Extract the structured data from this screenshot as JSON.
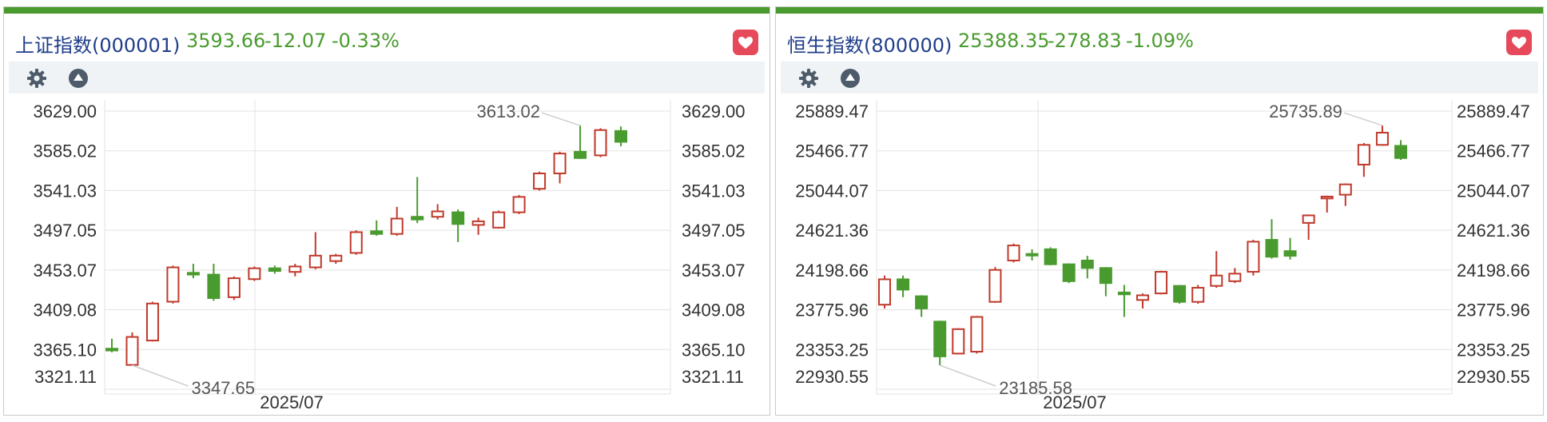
{
  "panels": [
    {
      "name": "上证指数",
      "code": "(000001)",
      "price": "3593.66",
      "change": "-12.07",
      "pct": "-0.33%",
      "chart_data": {
        "type": "candlestick",
        "x_label": "2025/07",
        "y_ticks": [
          "3629.00",
          "3585.02",
          "3541.03",
          "3497.05",
          "3453.07",
          "3409.08",
          "3365.10",
          "3321.11"
        ],
        "ylim": [
          3321.11,
          3629.0
        ],
        "annotations": {
          "high": "3613.02",
          "low": "3347.65"
        },
        "candles": [
          {
            "o": 3366.0,
            "c": 3364.0,
            "h": 3377.0,
            "l": 3362.0
          },
          {
            "o": 3348.0,
            "c": 3379.0,
            "h": 3384.0,
            "l": 3347.65
          },
          {
            "o": 3375.0,
            "c": 3416.0,
            "h": 3418.0,
            "l": 3374.0
          },
          {
            "o": 3418.0,
            "c": 3456.0,
            "h": 3458.0,
            "l": 3416.0
          },
          {
            "o": 3450.0,
            "c": 3448.0,
            "h": 3460.0,
            "l": 3444.0
          },
          {
            "o": 3448.0,
            "c": 3422.0,
            "h": 3460.0,
            "l": 3419.0
          },
          {
            "o": 3423.0,
            "c": 3444.0,
            "h": 3446.0,
            "l": 3420.0
          },
          {
            "o": 3443.0,
            "c": 3455.0,
            "h": 3457.0,
            "l": 3441.0
          },
          {
            "o": 3455.0,
            "c": 3452.0,
            "h": 3458.0,
            "l": 3449.0
          },
          {
            "o": 3451.0,
            "c": 3457.0,
            "h": 3460.0,
            "l": 3446.0
          },
          {
            "o": 3456.0,
            "c": 3469.0,
            "h": 3495.0,
            "l": 3454.0
          },
          {
            "o": 3463.0,
            "c": 3469.0,
            "h": 3471.0,
            "l": 3460.0
          },
          {
            "o": 3472.0,
            "c": 3495.0,
            "h": 3497.0,
            "l": 3470.0
          },
          {
            "o": 3496.0,
            "c": 3493.0,
            "h": 3508.0,
            "l": 3491.0
          },
          {
            "o": 3493.0,
            "c": 3510.0,
            "h": 3523.0,
            "l": 3491.0
          },
          {
            "o": 3512.0,
            "c": 3509.0,
            "h": 3556.0,
            "l": 3505.0
          },
          {
            "o": 3512.0,
            "c": 3518.0,
            "h": 3526.0,
            "l": 3509.0
          },
          {
            "o": 3517.0,
            "c": 3504.0,
            "h": 3520.0,
            "l": 3484.0
          },
          {
            "o": 3503.0,
            "c": 3507.0,
            "h": 3511.0,
            "l": 3492.0
          },
          {
            "o": 3500.0,
            "c": 3517.0,
            "h": 3519.0,
            "l": 3499.0
          },
          {
            "o": 3517.0,
            "c": 3534.0,
            "h": 3536.0,
            "l": 3515.0
          },
          {
            "o": 3543.0,
            "c": 3560.0,
            "h": 3562.0,
            "l": 3541.0
          },
          {
            "o": 3560.0,
            "c": 3582.0,
            "h": 3584.0,
            "l": 3549.0
          },
          {
            "o": 3584.0,
            "c": 3577.0,
            "h": 3613.02,
            "l": 3576.0
          },
          {
            "o": 3580.0,
            "c": 3608.0,
            "h": 3610.0,
            "l": 3578.0
          },
          {
            "o": 3607.0,
            "c": 3595.0,
            "h": 3612.0,
            "l": 3590.0
          }
        ]
      }
    },
    {
      "name": "恒生指数",
      "code": "(800000)",
      "price": "25388.35",
      "change": "-278.83",
      "pct": "-1.09%",
      "chart_data": {
        "type": "candlestick",
        "x_label": "2025/07",
        "y_ticks": [
          "25889.47",
          "25466.77",
          "25044.07",
          "24621.36",
          "24198.66",
          "23775.96",
          "23353.25",
          "22930.55"
        ],
        "ylim": [
          22930.55,
          25889.47
        ],
        "annotations": {
          "high": "25735.89",
          "low": "23185.58"
        },
        "candles": [
          {
            "o": 23830.0,
            "c": 24100.0,
            "h": 24140.0,
            "l": 23790.0
          },
          {
            "o": 24100.0,
            "c": 23990.0,
            "h": 24140.0,
            "l": 23910.0
          },
          {
            "o": 23920.0,
            "c": 23790.0,
            "h": 23930.0,
            "l": 23700.0
          },
          {
            "o": 23650.0,
            "c": 23280.0,
            "h": 23660.0,
            "l": 23185.58
          },
          {
            "o": 23310.0,
            "c": 23570.0,
            "h": 23580.0,
            "l": 23300.0
          },
          {
            "o": 23330.0,
            "c": 23700.0,
            "h": 23710.0,
            "l": 23310.0
          },
          {
            "o": 23860.0,
            "c": 24200.0,
            "h": 24230.0,
            "l": 23850.0
          },
          {
            "o": 24300.0,
            "c": 24460.0,
            "h": 24480.0,
            "l": 24280.0
          },
          {
            "o": 24370.0,
            "c": 24360.0,
            "h": 24420.0,
            "l": 24300.0
          },
          {
            "o": 24420.0,
            "c": 24260.0,
            "h": 24440.0,
            "l": 24250.0
          },
          {
            "o": 24260.0,
            "c": 24080.0,
            "h": 24270.0,
            "l": 24060.0
          },
          {
            "o": 24300.0,
            "c": 24220.0,
            "h": 24350.0,
            "l": 24110.0
          },
          {
            "o": 24220.0,
            "c": 24060.0,
            "h": 24230.0,
            "l": 23920.0
          },
          {
            "o": 23960.0,
            "c": 23940.0,
            "h": 24040.0,
            "l": 23700.0
          },
          {
            "o": 23880.0,
            "c": 23930.0,
            "h": 23950.0,
            "l": 23790.0
          },
          {
            "o": 23950.0,
            "c": 24180.0,
            "h": 24190.0,
            "l": 23940.0
          },
          {
            "o": 24030.0,
            "c": 23860.0,
            "h": 24040.0,
            "l": 23840.0
          },
          {
            "o": 23860.0,
            "c": 24010.0,
            "h": 24040.0,
            "l": 23840.0
          },
          {
            "o": 24030.0,
            "c": 24140.0,
            "h": 24400.0,
            "l": 24010.0
          },
          {
            "o": 24080.0,
            "c": 24160.0,
            "h": 24220.0,
            "l": 24060.0
          },
          {
            "o": 24180.0,
            "c": 24500.0,
            "h": 24520.0,
            "l": 24140.0
          },
          {
            "o": 24520.0,
            "c": 24340.0,
            "h": 24740.0,
            "l": 24320.0
          },
          {
            "o": 24400.0,
            "c": 24350.0,
            "h": 24540.0,
            "l": 24310.0
          },
          {
            "o": 24700.0,
            "c": 24780.0,
            "h": 24790.0,
            "l": 24520.0
          },
          {
            "o": 24960.0,
            "c": 24980.0,
            "h": 24990.0,
            "l": 24810.0
          },
          {
            "o": 25000.0,
            "c": 25110.0,
            "h": 25120.0,
            "l": 24880.0
          },
          {
            "o": 25320.0,
            "c": 25530.0,
            "h": 25550.0,
            "l": 25190.0
          },
          {
            "o": 25530.0,
            "c": 25660.0,
            "h": 25735.89,
            "l": 25520.0
          },
          {
            "o": 25520.0,
            "c": 25390.0,
            "h": 25580.0,
            "l": 25370.0
          }
        ]
      }
    }
  ],
  "colors": {
    "up": "#c0392b",
    "down": "#4a9b2f",
    "grid": "#e3e3e3",
    "axis_text": "#333333"
  }
}
